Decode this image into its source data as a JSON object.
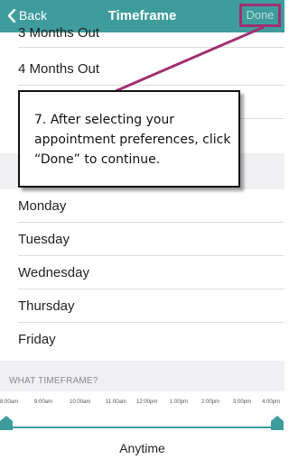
{
  "navbar": {
    "back_label": "Back",
    "title": "Timeframe",
    "done_label": "Done"
  },
  "timeframe_options": [
    "3 Months Out",
    "4 Months Out"
  ],
  "days": [
    "Monday",
    "Tuesday",
    "Wednesday",
    "Thursday",
    "Friday"
  ],
  "section_header": "WHAT TIMEFRAME?",
  "time_labels": [
    "8:00am",
    "9:00am",
    "10:00am",
    "11:00am",
    "12:00pm",
    "1:00pm",
    "2:00pm",
    "3:00pm",
    "4:00pm"
  ],
  "slider_value": "Anytime",
  "callout_text": "7. After selecting your appointment preferences, click “Done” to continue.",
  "colors": {
    "accent": "#3f9c9c",
    "highlight": "#a03070"
  }
}
